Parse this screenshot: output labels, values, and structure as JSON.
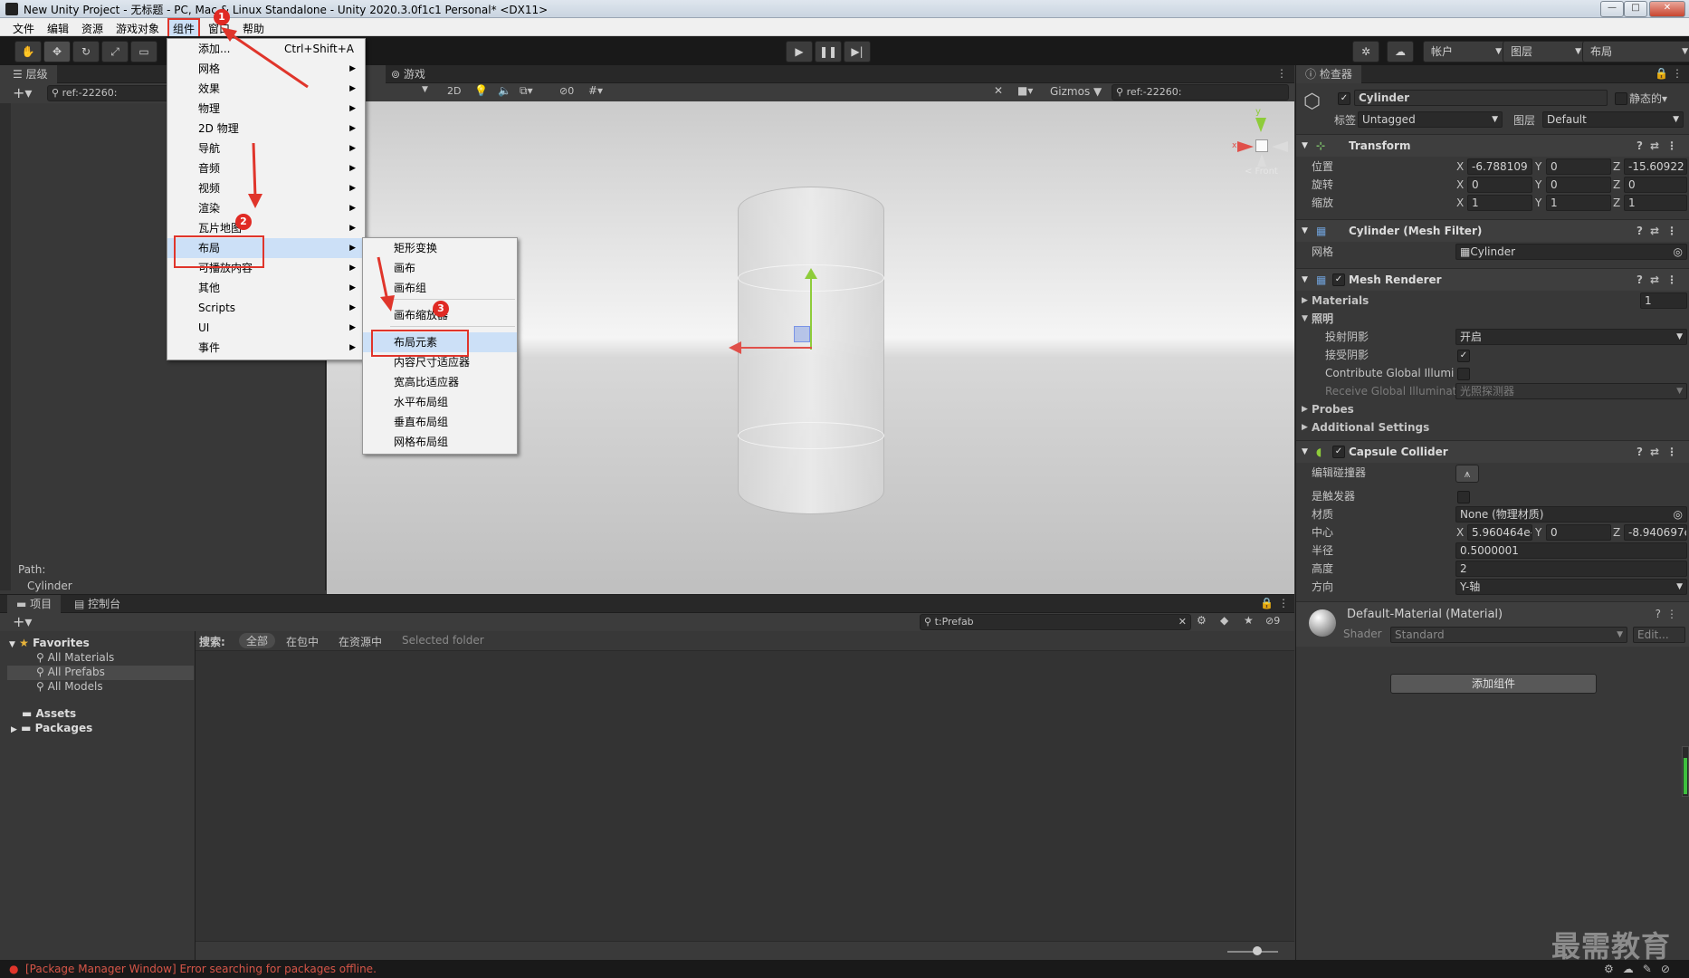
{
  "window": {
    "title": "New Unity Project - 无标题 - PC, Mac & Linux Standalone - Unity 2020.3.0f1c1 Personal* <DX11>",
    "controls": [
      "—",
      "□",
      "✕"
    ]
  },
  "menubar": {
    "items": [
      "文件",
      "编辑",
      "资源",
      "游戏对象",
      "组件",
      "窗口",
      "帮助"
    ]
  },
  "toolbar": {
    "account_label": "帐户",
    "layers_label": "图层",
    "layout_label": "布局"
  },
  "hierarchy": {
    "tab": "层级",
    "search_text": "ref:-22260:",
    "path_label": "Path:",
    "path_value": "Cylinder"
  },
  "scene": {
    "game_tab": "游戏",
    "mode_2d": "2D",
    "fx_count": "0",
    "gizmos_label": "Gizmos",
    "search_text": "ref:-22260:",
    "persp_label": "< Front"
  },
  "component_menu": {
    "items": [
      {
        "label": "添加...",
        "shortcut": "Ctrl+Shift+A"
      },
      {
        "label": "网格",
        "sub": true
      },
      {
        "label": "效果",
        "sub": true
      },
      {
        "label": "物理",
        "sub": true
      },
      {
        "label": "2D 物理",
        "sub": true
      },
      {
        "label": "导航",
        "sub": true
      },
      {
        "label": "音频",
        "sub": true
      },
      {
        "label": "视频",
        "sub": true
      },
      {
        "label": "渲染",
        "sub": true
      },
      {
        "label": "瓦片地图",
        "sub": true
      },
      {
        "label": "布局",
        "sub": true
      },
      {
        "label": "可播放内容",
        "sub": true
      },
      {
        "label": "其他",
        "sub": true
      },
      {
        "label": "Scripts",
        "sub": true
      },
      {
        "label": "UI",
        "sub": true
      },
      {
        "label": "事件",
        "sub": true
      }
    ]
  },
  "layout_submenu": {
    "items": [
      "矩形变换",
      "画布",
      "画布组",
      "画布缩放器",
      "布局元素",
      "内容尺寸适应器",
      "宽高比适应器",
      "水平布局组",
      "垂直布局组",
      "网格布局组"
    ]
  },
  "annotations": {
    "badges": [
      "1",
      "2",
      "3"
    ]
  },
  "inspector": {
    "tab": "检查器",
    "object_name": "Cylinder",
    "static_label": "静态的",
    "tag_label": "标签",
    "tag_value": "Untagged",
    "layer_label": "图层",
    "layer_value": "Default",
    "transform": {
      "title": "Transform",
      "position_label": "位置",
      "rotation_label": "旋转",
      "scale_label": "缩放",
      "position": {
        "x": "-6.788109",
        "y": "0",
        "z": "-15.60922"
      },
      "rotation": {
        "x": "0",
        "y": "0",
        "z": "0"
      },
      "scale": {
        "x": "1",
        "y": "1",
        "z": "1"
      }
    },
    "mesh_filter": {
      "title": "Cylinder (Mesh Filter)",
      "mesh_label": "网格",
      "mesh_value": "Cylinder"
    },
    "mesh_renderer": {
      "title": "Mesh Renderer",
      "materials_label": "Materials",
      "materials_count": "1",
      "lighting_label": "照明",
      "cast_shadows_label": "投射阴影",
      "cast_shadows_value": "开启",
      "receive_shadows_label": "接受阴影",
      "contribute_gi_label": "Contribute Global Illumi",
      "receive_gi_label": "Receive Global Illuminat",
      "receive_gi_value": "光照探测器",
      "probes_label": "Probes",
      "additional_label": "Additional Settings"
    },
    "capsule_collider": {
      "title": "Capsule Collider",
      "edit_collider_label": "编辑碰撞器",
      "is_trigger_label": "是触发器",
      "material_label": "材质",
      "material_value": "None (物理材质)",
      "center_label": "中心",
      "center": {
        "x": "5.960464e-",
        "y": "0",
        "z": "-8.940697e"
      },
      "radius_label": "半径",
      "radius_value": "0.5000001",
      "height_label": "高度",
      "height_value": "2",
      "direction_label": "方向",
      "direction_value": "Y-轴"
    },
    "material": {
      "title": "Default-Material (Material)",
      "shader_label": "Shader",
      "shader_value": "Standard",
      "edit_label": "Edit..."
    },
    "add_component": "添加组件"
  },
  "project": {
    "tab_project": "项目",
    "tab_console": "控制台",
    "search_text": "t:Prefab",
    "hidden_count": "9",
    "filter_label": "搜索:",
    "filter_all": "全部",
    "filter_packages": "在包中",
    "filter_assets": "在资源中",
    "filter_selected": "Selected folder",
    "favorites_label": "Favorites",
    "favorites": [
      "All Materials",
      "All Prefabs",
      "All Models"
    ],
    "assets_label": "Assets",
    "packages_label": "Packages"
  },
  "status": {
    "message": "[Package Manager Window] Error searching for packages offline."
  },
  "watermark": "最需教育"
}
